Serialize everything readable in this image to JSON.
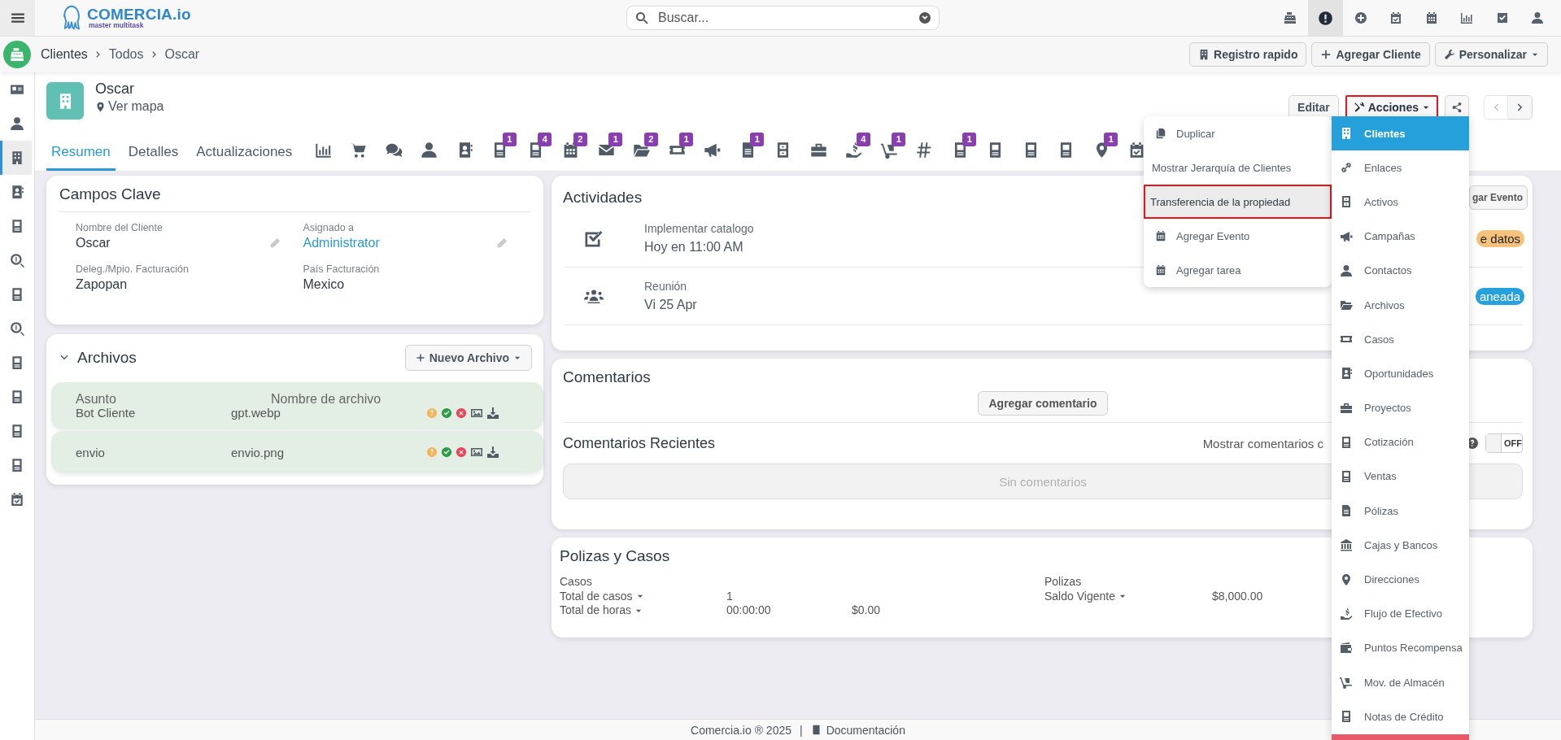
{
  "top_bar": {
    "logo": {
      "name": "COMERCIA.io",
      "tagline": "master multitask"
    },
    "search": {
      "placeholder": "Buscar..."
    },
    "toolbar": [
      {
        "kind": "cash-register",
        "selected": false
      },
      {
        "kind": "alert",
        "selected": true
      },
      {
        "kind": "plus-circle",
        "selected": false
      },
      {
        "kind": "calendar-check",
        "selected": false
      },
      {
        "kind": "calendar",
        "selected": false
      },
      {
        "kind": "bar-chart",
        "selected": false
      },
      {
        "kind": "check-square",
        "selected": false
      },
      {
        "kind": "user",
        "selected": false
      }
    ]
  },
  "breadcrumb": [
    "Clientes",
    "Todos",
    "Oscar"
  ],
  "header_buttons": [
    {
      "kind": "building",
      "label": "Registro rapido",
      "dropdown": false
    },
    {
      "kind": "plus",
      "label": "Agregar Cliente",
      "dropdown": false
    },
    {
      "kind": "wrench",
      "label": "Personalizar",
      "dropdown": true
    }
  ],
  "sidebar": {
    "items": [
      {
        "kind": "id-card",
        "selected": false
      },
      {
        "kind": "user",
        "selected": false
      },
      {
        "kind": "building",
        "selected": true
      },
      {
        "kind": "contact-card",
        "selected": false
      },
      {
        "kind": "document",
        "selected": false
      },
      {
        "kind": "search-dollar",
        "selected": false
      },
      {
        "kind": "document",
        "selected": false
      },
      {
        "kind": "search-dollar",
        "selected": false
      },
      {
        "kind": "document",
        "selected": false
      },
      {
        "kind": "document",
        "selected": false
      },
      {
        "kind": "document",
        "selected": false
      },
      {
        "kind": "document",
        "selected": false
      },
      {
        "kind": "calendar-check",
        "selected": false
      }
    ]
  },
  "record": {
    "name": "Oscar",
    "map_link": "Ver mapa",
    "actions": [
      {
        "kind": "text",
        "label": "Editar",
        "highlighted": false,
        "dropdown": false
      },
      {
        "kind": "tools",
        "label": "Acciones",
        "highlighted": true,
        "dropdown": true
      }
    ],
    "nav": [
      {
        "kind": "prev",
        "disabled": true
      },
      {
        "kind": "next",
        "disabled": false
      }
    ]
  },
  "tabs": [
    {
      "kind": "text",
      "label": "Resumen",
      "selected": true
    },
    {
      "kind": "text",
      "label": "Detalles",
      "selected": false
    },
    {
      "kind": "text",
      "label": "Actualizaciones",
      "selected": false
    },
    {
      "kind": "bar-chart",
      "selected": false
    },
    {
      "kind": "cart",
      "selected": false
    },
    {
      "kind": "comments",
      "selected": false
    },
    {
      "kind": "user",
      "selected": false
    },
    {
      "kind": "contact-card",
      "selected": false
    },
    {
      "kind": "document",
      "badge": "1",
      "selected": false
    },
    {
      "kind": "document",
      "badge": "4",
      "selected": false
    },
    {
      "kind": "calendar",
      "badge": "2",
      "selected": false
    },
    {
      "kind": "envelope",
      "badge": "1",
      "selected": false
    },
    {
      "kind": "folder",
      "badge": "2",
      "selected": false
    },
    {
      "kind": "ticket",
      "badge": "1",
      "selected": false
    },
    {
      "kind": "megaphone",
      "selected": false
    },
    {
      "kind": "file",
      "badge": "1",
      "selected": false
    },
    {
      "kind": "cabinet",
      "selected": false
    },
    {
      "kind": "briefcase",
      "selected": false
    },
    {
      "kind": "hand-dollar",
      "badge": "4",
      "selected": false
    },
    {
      "kind": "hand-truck",
      "badge": "1",
      "selected": false
    },
    {
      "kind": "hash",
      "selected": false
    },
    {
      "kind": "document",
      "badge": "1",
      "selected": false
    },
    {
      "kind": "document",
      "selected": false
    },
    {
      "kind": "document",
      "selected": false
    },
    {
      "kind": "document",
      "selected": false
    },
    {
      "kind": "map-pin",
      "badge": "1",
      "selected": false
    },
    {
      "kind": "calendar-check",
      "selected": false
    }
  ],
  "key_fields": {
    "title": "Campos Clave",
    "fields": [
      {
        "label": "Nombre del Cliente",
        "value": "Oscar",
        "link": false,
        "editable": true
      },
      {
        "label": "Asignado a",
        "value": "Administrator",
        "link": true,
        "editable": true
      },
      {
        "label": "Deleg./Mpio. Facturación",
        "value": "Zapopan",
        "link": false,
        "editable": false
      },
      {
        "label": "País Facturación",
        "value": "Mexico",
        "link": false,
        "editable": false
      }
    ]
  },
  "files": {
    "title": "Archivos",
    "expanded": true,
    "new_button": "Nuevo Archivo",
    "columns": [
      "Asunto",
      "Nombre de archivo"
    ],
    "rows": [
      {
        "subject": "Bot Cliente",
        "filename": "gpt.webp"
      },
      {
        "subject": "envio",
        "filename": "envio.png"
      }
    ]
  },
  "activities": {
    "title": "Actividades",
    "add_button": "gar Evento",
    "items": [
      {
        "kind": "task",
        "title": "Implementar catalogo",
        "when": "Hoy en 11:00 AM",
        "status": "e datos",
        "color": "#f6c27b"
      },
      {
        "kind": "meeting",
        "title": "Reunión",
        "when": "Vi 25 Apr",
        "status": "aneada",
        "color": "#27a1dc"
      }
    ]
  },
  "comments": {
    "title": "Comentarios",
    "add_button": "Agregar comentario",
    "recent_title": "Comentarios Recientes",
    "show_label": "Mostrar comentarios c",
    "toggle": {
      "on": false,
      "label": "OFF"
    },
    "empty": "Sin comentarios"
  },
  "policies": {
    "title": "Polizas y Casos",
    "groups": [
      {
        "title": "Casos",
        "rows": [
          {
            "label": "Total de casos",
            "values": [
              "1"
            ]
          },
          {
            "label": "Total de horas",
            "values": [
              "00:00:00",
              "$0.00"
            ]
          }
        ]
      },
      {
        "title": "Polizas",
        "rows": [
          {
            "label": "Saldo Vigente",
            "values": [
              "$8,000.00"
            ]
          }
        ]
      }
    ]
  },
  "actions_menu": {
    "items": [
      {
        "kind": "copy",
        "label": "Duplicar",
        "highlighted": false
      },
      {
        "kind": "text",
        "label": "Mostrar Jerarquía de Clientes",
        "highlighted": false
      },
      {
        "kind": "text",
        "label": "Transferencia de la propiedad",
        "highlighted": true
      },
      {
        "kind": "calendar",
        "label": "Agregar Evento",
        "highlighted": false
      },
      {
        "kind": "calendar",
        "label": "Agregar tarea",
        "highlighted": false
      }
    ]
  },
  "related_menu": {
    "items": [
      {
        "kind": "building",
        "label": "Clientes",
        "selected": true
      },
      {
        "kind": "link",
        "label": "Enlaces",
        "selected": false
      },
      {
        "kind": "cabinet",
        "label": "Activos",
        "selected": false
      },
      {
        "kind": "megaphone",
        "label": "Campañas",
        "selected": false
      },
      {
        "kind": "user",
        "label": "Contactos",
        "selected": false
      },
      {
        "kind": "folder",
        "label": "Archivos",
        "selected": false
      },
      {
        "kind": "ticket",
        "label": "Casos",
        "selected": false
      },
      {
        "kind": "contact-card",
        "label": "Oportunidades",
        "selected": false
      },
      {
        "kind": "briefcase",
        "label": "Proyectos",
        "selected": false
      },
      {
        "kind": "document",
        "label": "Cotización",
        "selected": false
      },
      {
        "kind": "document",
        "label": "Ventas",
        "selected": false
      },
      {
        "kind": "file",
        "label": "Pólizas",
        "selected": false
      },
      {
        "kind": "bank",
        "label": "Cajas y Bancos",
        "selected": false
      },
      {
        "kind": "map-pin",
        "label": "Direcciones",
        "selected": false
      },
      {
        "kind": "hand-dollar",
        "label": "Flujo de Efectivo",
        "selected": false
      },
      {
        "kind": "wallet",
        "label": "Puntos Recompensa",
        "selected": false
      },
      {
        "kind": "hand-truck",
        "label": "Mov. de Almacén",
        "selected": false
      },
      {
        "kind": "document",
        "label": "Notas de Crédito",
        "selected": false
      }
    ]
  },
  "footer": {
    "text": "Comercia.io ® 2025",
    "separator": "|",
    "link": "Documentación"
  }
}
